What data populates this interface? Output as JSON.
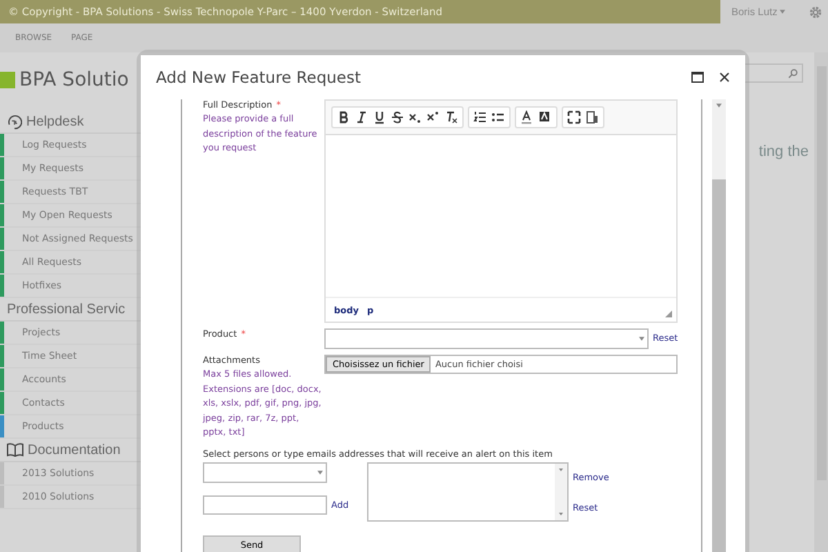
{
  "top_bar": {
    "copyright": "© Copyright - BPA Solutions - Swiss Technopole Y-Parc – 1400 Yverdon - Switzerland",
    "user": "Boris Lutz"
  },
  "ribbon": {
    "tabs": [
      "BROWSE",
      "PAGE"
    ]
  },
  "sidebar": {
    "logo": "BPA Solutio",
    "sections": [
      {
        "title": "Helpdesk",
        "items": [
          {
            "label": "Log Requests",
            "color": "#2e9a5e"
          },
          {
            "label": "My Requests",
            "color": "#2e9a5e"
          },
          {
            "label": "Requests TBT",
            "color": "#2e9a5e"
          },
          {
            "label": "My Open Requests",
            "color": "#2e9a5e"
          },
          {
            "label": "Not Assigned Requests",
            "color": "#2e9a5e"
          },
          {
            "label": "All Requests",
            "color": "#2e9a5e"
          },
          {
            "label": "Hotfixes",
            "color": "#2e9a5e"
          }
        ]
      },
      {
        "title": "Professional Servic",
        "items": [
          {
            "label": "Projects",
            "color": "#2e9a5e"
          },
          {
            "label": "Time Sheet",
            "color": "#2e9a5e"
          },
          {
            "label": "Accounts",
            "color": "#2e9a5e"
          },
          {
            "label": "Contacts",
            "color": "#2e9a5e"
          },
          {
            "label": "Products",
            "color": "#3a8fc4"
          }
        ]
      },
      {
        "title": "Documentation",
        "items": [
          {
            "label": "2013 Solutions",
            "color": "#bdbdbd"
          },
          {
            "label": "2010 Solutions",
            "color": "#bdbdbd"
          }
        ]
      }
    ]
  },
  "main": {
    "text": "ting the"
  },
  "dialog": {
    "title": "Add New Feature Request",
    "description": {
      "label": "Full Description",
      "required_mark": "*",
      "hint": "Please provide a full description of the feature you request",
      "path": [
        "body",
        "p"
      ]
    },
    "product": {
      "label": "Product",
      "required_mark": "*",
      "reset": "Reset"
    },
    "attachments": {
      "label": "Attachments",
      "hint": "Max 5 files allowed. Extensions are [doc, docx, xls, xslx, pdf, gif, png, jpg, jpeg, zip, rar, 7z, ppt, pptx, txt]",
      "button": "Choisissez un fichier",
      "status": "Aucun fichier choisi"
    },
    "recipients": {
      "label": "Select persons or type emails addresses that will receive an alert on this item",
      "add": "Add",
      "remove": "Remove",
      "reset": "Reset"
    },
    "send": "Send"
  }
}
